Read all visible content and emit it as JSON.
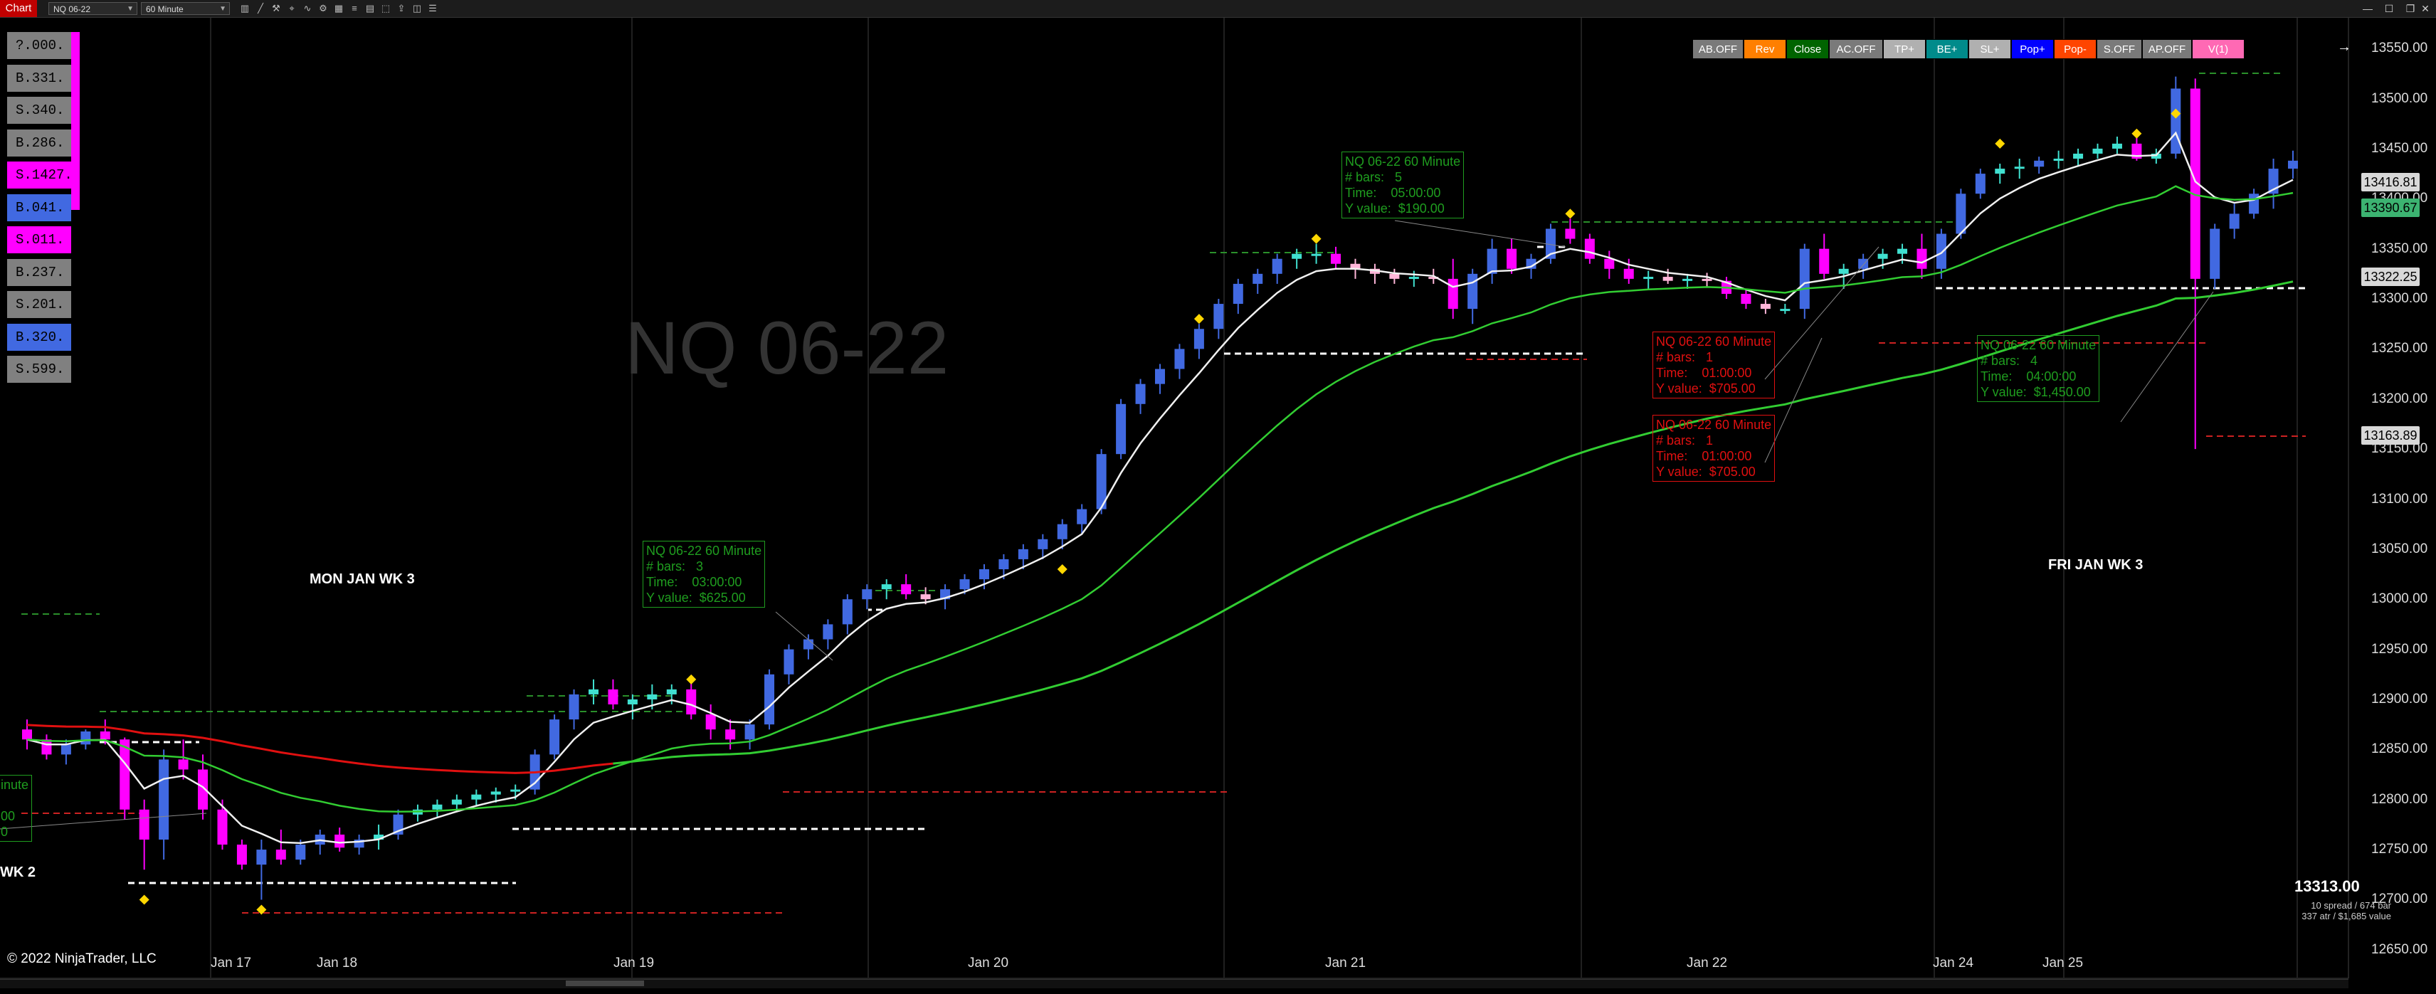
{
  "toolbar": {
    "tab_label": "Chart",
    "instrument": "NQ 06-22",
    "interval": "60 Minute",
    "icons": [
      "bar-type-icon",
      "draw-line-icon",
      "tools-icon",
      "pointer-icon",
      "indicator-icon",
      "strategy-icon",
      "template-icon",
      "properties-icon"
    ]
  },
  "watermark": "NQ 06-22",
  "chart_buttons": [
    {
      "label": "AB.OFF",
      "bg": "#7a7a7a"
    },
    {
      "label": "Rev",
      "bg": "#ff7f00"
    },
    {
      "label": "Close",
      "bg": "#006400"
    },
    {
      "label": "AC.OFF",
      "bg": "#7a7a7a"
    },
    {
      "label": "TP+",
      "bg": "#b0b0b0"
    },
    {
      "label": "BE+",
      "bg": "#008b8b"
    },
    {
      "label": "SL+",
      "bg": "#b0b0b0"
    },
    {
      "label": "Pop+",
      "bg": "#0000ff"
    },
    {
      "label": "Pop-",
      "bg": "#ff4500"
    },
    {
      "label": "S.OFF",
      "bg": "#7a7a7a"
    },
    {
      "label": "AP.OFF",
      "bg": "#7a7a7a"
    },
    {
      "label": "V(1)",
      "bg": "#ff69b4"
    }
  ],
  "side_labels": [
    {
      "label": "?.000.",
      "bg": "#808080"
    },
    {
      "label": "B.331.",
      "bg": "#808080"
    },
    {
      "label": "S.340.",
      "bg": "#808080"
    },
    {
      "label": "B.286.",
      "bg": "#808080"
    },
    {
      "label": "S.1427.",
      "bg": "#ff00ff"
    },
    {
      "label": "B.041.",
      "bg": "#4169e1"
    },
    {
      "label": "S.011.",
      "bg": "#ff00ff"
    },
    {
      "label": "B.237.",
      "bg": "#808080"
    },
    {
      "label": "S.201.",
      "bg": "#808080"
    },
    {
      "label": "B.320.",
      "bg": "#4169e1"
    },
    {
      "label": "S.599.",
      "bg": "#808080"
    }
  ],
  "week_labels": {
    "mon": "MON JAN WK 3",
    "fri": "FRI JAN WK 3",
    "prev": "WK 2"
  },
  "info_boxes": [
    {
      "id": "a",
      "lines": "NQ 06-22 60 Minute\n# bars:   5\nTime:    05:00:00\nY value:  $190.00",
      "color": "#1f9d1f"
    },
    {
      "id": "b",
      "lines": "NQ 06-22 60 Minute\n# bars:   3\nTime:    03:00:00\nY value:  $625.00",
      "color": "#1f9d1f"
    },
    {
      "id": "c",
      "lines": "NQ 06-22 60 Minute\n# bars:   1\nTime:    01:00:00\nY value:  $705.00",
      "color": "#e01010"
    },
    {
      "id": "d",
      "lines": "NQ 06-22 60 Minute\n# bars:   1\nTime:    01:00:00\nY value:  $705.00",
      "color": "#e01010"
    },
    {
      "id": "e",
      "lines": "NQ 06-22 60 Minute\n# bars:   4\nTime:    04:00:00\nY value:  $1,450.00",
      "color": "#1f9d1f"
    },
    {
      "id": "f",
      "lines": "inute\n\n00\n0",
      "color": "#1f9d1f"
    }
  ],
  "price_tags": [
    {
      "label": "13416.81",
      "bg": "#d8d8d8",
      "value": 13416.81
    },
    {
      "label": "13390.67",
      "bg": "#3cb371",
      "value": 13390.67
    },
    {
      "label": "13322.25",
      "bg": "#d8d8d8",
      "value": 13322.25
    },
    {
      "label": "13163.89",
      "bg": "#d8d8d8",
      "value": 13163.89
    }
  ],
  "last_price": "13313.00",
  "spread_line1": "10 spread / 674 bar",
  "spread_line2": "337 atr / $1,685 value",
  "copyright": "© 2022 NinjaTrader, LLC",
  "chart_data": {
    "type": "candlestick",
    "instrument": "NQ 06-22",
    "interval": "60 Minute",
    "ylim": [
      12625,
      13575
    ],
    "y_ticks": [
      "13550.00",
      "13500.00",
      "13450.00",
      "13400.00",
      "13350.00",
      "13300.00",
      "13250.00",
      "13200.00",
      "13150.00",
      "13100.00",
      "13050.00",
      "13000.00",
      "12950.00",
      "12900.00",
      "12850.00",
      "12800.00",
      "12750.00",
      "12700.00",
      "12650.00"
    ],
    "x_ticks": [
      "Jan 17",
      "Jan 18",
      "Jan 19",
      "Jan 20",
      "Jan 21",
      "Jan 22",
      "Jan 24",
      "Jan 25"
    ],
    "candles": [
      [
        12870,
        12880,
        12850,
        12860
      ],
      [
        12860,
        12865,
        12840,
        12845
      ],
      [
        12845,
        12860,
        12835,
        12855
      ],
      [
        12855,
        12870,
        12850,
        12868
      ],
      [
        12868,
        12880,
        12855,
        12860
      ],
      [
        12860,
        12862,
        12780,
        12790
      ],
      [
        12790,
        12800,
        12730,
        12760
      ],
      [
        12760,
        12850,
        12740,
        12840
      ],
      [
        12840,
        12860,
        12820,
        12830
      ],
      [
        12830,
        12845,
        12780,
        12790
      ],
      [
        12790,
        12800,
        12750,
        12755
      ],
      [
        12755,
        12760,
        12730,
        12735
      ],
      [
        12735,
        12760,
        12700,
        12750
      ],
      [
        12750,
        12770,
        12735,
        12740
      ],
      [
        12740,
        12760,
        12735,
        12755
      ],
      [
        12755,
        12770,
        12745,
        12765
      ],
      [
        12765,
        12772,
        12748,
        12752
      ],
      [
        12752,
        12765,
        12745,
        12760
      ],
      [
        12760,
        12775,
        12750,
        12765
      ],
      [
        12765,
        12790,
        12760,
        12785
      ],
      [
        12785,
        12795,
        12778,
        12790
      ],
      [
        12790,
        12800,
        12783,
        12795
      ],
      [
        12795,
        12805,
        12788,
        12800
      ],
      [
        12800,
        12810,
        12793,
        12805
      ],
      [
        12805,
        12812,
        12797,
        12808
      ],
      [
        12808,
        12815,
        12800,
        12810
      ],
      [
        12810,
        12850,
        12805,
        12845
      ],
      [
        12845,
        12885,
        12840,
        12880
      ],
      [
        12880,
        12910,
        12870,
        12905
      ],
      [
        12905,
        12920,
        12895,
        12910
      ],
      [
        12910,
        12920,
        12890,
        12895
      ],
      [
        12895,
        12905,
        12880,
        12900
      ],
      [
        12900,
        12915,
        12890,
        12905
      ],
      [
        12905,
        12915,
        12895,
        12910
      ],
      [
        12910,
        12920,
        12880,
        12885
      ],
      [
        12885,
        12895,
        12860,
        12870
      ],
      [
        12870,
        12880,
        12850,
        12860
      ],
      [
        12860,
        12880,
        12850,
        12875
      ],
      [
        12875,
        12930,
        12870,
        12925
      ],
      [
        12925,
        12955,
        12915,
        12950
      ],
      [
        12950,
        12965,
        12940,
        12960
      ],
      [
        12960,
        12980,
        12950,
        12975
      ],
      [
        12975,
        13005,
        12965,
        13000
      ],
      [
        13000,
        13015,
        12990,
        13010
      ],
      [
        13010,
        13020,
        13000,
        13015
      ],
      [
        13015,
        13025,
        13000,
        13005
      ],
      [
        13005,
        13012,
        12995,
        13000
      ],
      [
        13000,
        13015,
        12990,
        13010
      ],
      [
        13010,
        13025,
        13005,
        13020
      ],
      [
        13020,
        13035,
        13010,
        13030
      ],
      [
        13030,
        13045,
        13020,
        13040
      ],
      [
        13040,
        13055,
        13030,
        13050
      ],
      [
        13050,
        13065,
        13040,
        13060
      ],
      [
        13060,
        13080,
        13050,
        13075
      ],
      [
        13075,
        13095,
        13065,
        13090
      ],
      [
        13090,
        13150,
        13085,
        13145
      ],
      [
        13145,
        13200,
        13140,
        13195
      ],
      [
        13195,
        13220,
        13185,
        13215
      ],
      [
        13215,
        13235,
        13205,
        13230
      ],
      [
        13230,
        13255,
        13220,
        13250
      ],
      [
        13250,
        13275,
        13240,
        13270
      ],
      [
        13270,
        13300,
        13260,
        13295
      ],
      [
        13295,
        13320,
        13285,
        13315
      ],
      [
        13315,
        13330,
        13305,
        13325
      ],
      [
        13325,
        13345,
        13315,
        13340
      ],
      [
        13340,
        13350,
        13330,
        13345
      ],
      [
        13345,
        13355,
        13335,
        13345
      ],
      [
        13345,
        13352,
        13330,
        13335
      ],
      [
        13335,
        13340,
        13320,
        13330
      ],
      [
        13330,
        13335,
        13315,
        13325
      ],
      [
        13325,
        13330,
        13315,
        13320
      ],
      [
        13320,
        13328,
        13312,
        13322
      ],
      [
        13322,
        13330,
        13315,
        13320
      ],
      [
        13320,
        13340,
        13280,
        13290
      ],
      [
        13290,
        13330,
        13275,
        13325
      ],
      [
        13325,
        13360,
        13315,
        13350
      ],
      [
        13350,
        13360,
        13325,
        13330
      ],
      [
        13330,
        13345,
        13320,
        13340
      ],
      [
        13340,
        13375,
        13335,
        13370
      ],
      [
        13370,
        13380,
        13355,
        13360
      ],
      [
        13360,
        13365,
        13335,
        13340
      ],
      [
        13340,
        13348,
        13320,
        13330
      ],
      [
        13330,
        13340,
        13315,
        13320
      ],
      [
        13320,
        13328,
        13310,
        13322
      ],
      [
        13322,
        13330,
        13315,
        13318
      ],
      [
        13318,
        13325,
        13310,
        13320
      ],
      [
        13320,
        13326,
        13312,
        13318
      ],
      [
        13318,
        13322,
        13300,
        13305
      ],
      [
        13305,
        13310,
        13290,
        13295
      ],
      [
        13295,
        13300,
        13285,
        13290
      ],
      [
        13290,
        13295,
        13285,
        13290
      ],
      [
        13290,
        13355,
        13280,
        13350
      ],
      [
        13350,
        13365,
        13320,
        13325
      ],
      [
        13325,
        13335,
        13310,
        13330
      ],
      [
        13330,
        13345,
        13320,
        13340
      ],
      [
        13340,
        13350,
        13330,
        13345
      ],
      [
        13345,
        13355,
        13335,
        13350
      ],
      [
        13350,
        13365,
        13320,
        13330
      ],
      [
        13330,
        13370,
        13320,
        13365
      ],
      [
        13365,
        13410,
        13360,
        13405
      ],
      [
        13405,
        13430,
        13400,
        13425
      ],
      [
        13425,
        13435,
        13415,
        13430
      ],
      [
        13430,
        13440,
        13420,
        13432
      ],
      [
        13432,
        13442,
        13425,
        13438
      ],
      [
        13438,
        13448,
        13430,
        13440
      ],
      [
        13440,
        13450,
        13432,
        13445
      ],
      [
        13445,
        13455,
        13440,
        13450
      ],
      [
        13450,
        13462,
        13445,
        13455
      ],
      [
        13455,
        13462,
        13438,
        13440
      ],
      [
        13440,
        13450,
        13435,
        13445
      ],
      [
        13445,
        13522,
        13440,
        13510
      ],
      [
        13510,
        13520,
        13150,
        13320
      ],
      [
        13320,
        13375,
        13310,
        13370
      ],
      [
        13370,
        13395,
        13360,
        13385
      ],
      [
        13385,
        13410,
        13380,
        13405
      ],
      [
        13405,
        13440,
        13390,
        13430
      ],
      [
        13430,
        13448,
        13420,
        13438
      ]
    ]
  }
}
